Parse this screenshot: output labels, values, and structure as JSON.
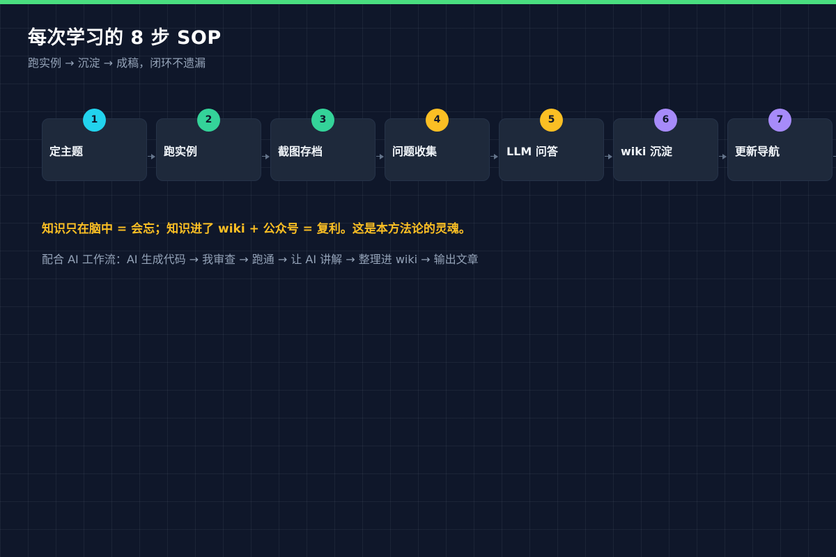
{
  "colors": {
    "background": "#0f172a",
    "top_accent": "#4ade80",
    "card": "#1e293b",
    "highlight": "#fbbf24",
    "muted_text": "#94a3b8"
  },
  "header": {
    "title": "每次学习的 8 步 SOP",
    "subtitle": "跑实例 → 沉淀 → 成稿，闭环不遗漏"
  },
  "steps": [
    {
      "number": "1",
      "label": "定主题",
      "badge_color": "#22d3ee"
    },
    {
      "number": "2",
      "label": "跑实例",
      "badge_color": "#34d399"
    },
    {
      "number": "3",
      "label": "截图存档",
      "badge_color": "#34d399"
    },
    {
      "number": "4",
      "label": "问题收集",
      "badge_color": "#fbbf24"
    },
    {
      "number": "5",
      "label": "LLM 问答",
      "badge_color": "#fbbf24"
    },
    {
      "number": "6",
      "label": "wiki 沉淀",
      "badge_color": "#a78bfa"
    },
    {
      "number": "7",
      "label": "更新导航",
      "badge_color": "#a78bfa"
    }
  ],
  "notes": {
    "highlight": "知识只在脑中 = 会忘；知识进了 wiki + 公众号 = 复利。这是本方法论的灵魂。",
    "workflow": "配合 AI 工作流：AI 生成代码 → 我审查 → 跑通 → 让 AI 讲解 → 整理进 wiki → 输出文章"
  }
}
